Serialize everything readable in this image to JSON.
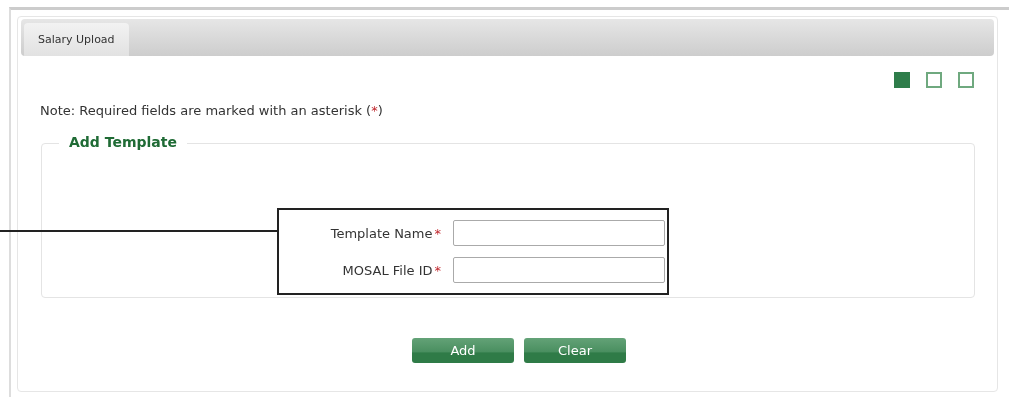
{
  "tabs": [
    {
      "label": "Salary Upload",
      "selected": true
    }
  ],
  "steps": [
    {
      "selected": true
    },
    {
      "selected": false
    },
    {
      "selected": false
    }
  ],
  "note": {
    "text": "Note: Required fields are marked with an asterisk (",
    "mark": "*",
    "end": ")"
  },
  "section": {
    "title": "Add Template",
    "fields": [
      {
        "label": "Template Name",
        "required": true
      },
      {
        "label": "MOSAL File ID",
        "required": true
      }
    ]
  },
  "buttons": [
    "Add",
    "Clear"
  ]
}
